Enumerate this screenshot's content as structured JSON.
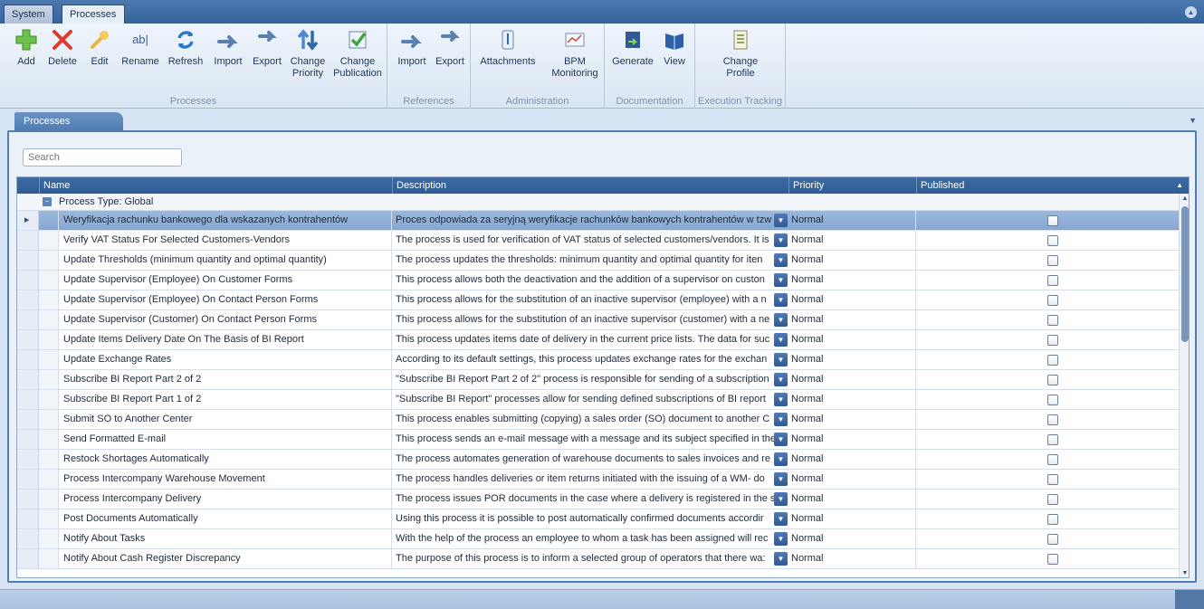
{
  "tabs": {
    "system": "System",
    "processes": "Processes"
  },
  "ribbon": {
    "groups": {
      "processes": "Processes",
      "references": "References",
      "administration": "Administration",
      "documentation": "Documentation",
      "execution_tracking": "Execution Tracking"
    },
    "buttons": {
      "add": "Add",
      "delete": "Delete",
      "edit": "Edit",
      "rename": "Rename",
      "refresh": "Refresh",
      "import": "Import",
      "export": "Export",
      "change_priority": "Change\nPriority",
      "change_publication": "Change\nPublication",
      "ref_import": "Import",
      "ref_export": "Export",
      "attachments": "Attachments",
      "bpm_monitoring": "BPM\nMonitoring",
      "generate": "Generate",
      "view": "View",
      "change_profile": "Change\nProfile"
    }
  },
  "doc_tab": "Processes",
  "search": {
    "placeholder": "Search"
  },
  "grid": {
    "columns": {
      "name": "Name",
      "description": "Description",
      "priority": "Priority",
      "published": "Published"
    },
    "group_label": "Process Type: Global",
    "rows": [
      {
        "name": "Weryfikacja rachunku bankowego dla wskazanych kontrahentów",
        "description": "Proces odpowiada za seryjną weryfikacje rachunków bankowych kontrahentów w tzw",
        "priority": "Normal",
        "published": false
      },
      {
        "name": "Verify VAT Status For Selected Customers-Vendors",
        "description": "The process is used for verification of VAT status of selected customers/vendors. It is",
        "priority": "Normal",
        "published": false
      },
      {
        "name": "Update Thresholds (minimum quantity and optimal quantity)",
        "description": "The process updates the thresholds: minimum quantity and optimal quantity for iten",
        "priority": "Normal",
        "published": false
      },
      {
        "name": "Update Supervisor (Employee) On Customer Forms",
        "description": "This process allows both the deactivation and the addition of a supervisor on custon",
        "priority": "Normal",
        "published": false
      },
      {
        "name": "Update Supervisor (Employee) On Contact Person Forms",
        "description": "This process allows for the substitution of an inactive supervisor (employee) with a n",
        "priority": "Normal",
        "published": false
      },
      {
        "name": "Update Supervisor (Customer) On Contact Person Forms",
        "description": "This process allows for the substitution of an inactive supervisor (customer) with a ne",
        "priority": "Normal",
        "published": false
      },
      {
        "name": "Update Items Delivery Date On The Basis of BI Report",
        "description": "This process updates items date of delivery in the current price lists. The data for suc",
        "priority": "Normal",
        "published": false
      },
      {
        "name": "Update Exchange Rates",
        "description": "According to its default settings, this process updates exchange rates for the exchan",
        "priority": "Normal",
        "published": false
      },
      {
        "name": "Subscribe BI Report Part 2 of 2",
        "description": "\"Subscribe BI Report Part 2 of 2\" process is responsible for sending of a subscription",
        "priority": "Normal",
        "published": false
      },
      {
        "name": "Subscribe BI Report Part 1 of 2",
        "description": "\"Subscribe BI Report\" processes allow for sending defined subscriptions of BI report",
        "priority": "Normal",
        "published": false
      },
      {
        "name": "Submit SO to Another Center",
        "description": "This process enables submitting (copying) a sales order (SO) document to another C",
        "priority": "Normal",
        "published": false
      },
      {
        "name": "Send Formatted E-mail",
        "description": "This process sends an e-mail message with a message and its subject specified in the",
        "priority": "Normal",
        "published": false
      },
      {
        "name": "Restock Shortages Automatically",
        "description": "The process automates generation of warehouse documents to sales invoices and re",
        "priority": "Normal",
        "published": false
      },
      {
        "name": "Process Intercompany Warehouse Movement",
        "description": "The process handles deliveries or item returns initiated with the issuing of a WM- do",
        "priority": "Normal",
        "published": false
      },
      {
        "name": "Process Intercompany Delivery",
        "description": "The process issues POR documents in the case where a delivery is registered in the s",
        "priority": "Normal",
        "published": false
      },
      {
        "name": "Post Documents Automatically",
        "description": "Using this process it is possible to post automatically confirmed documents accordir",
        "priority": "Normal",
        "published": false
      },
      {
        "name": "Notify About Tasks",
        "description": "With the help of the process an employee to whom a task has been assigned will rec",
        "priority": "Normal",
        "published": false
      },
      {
        "name": "Notify About Cash Register Discrepancy",
        "description": "The purpose of this process is to inform a selected group of operators that there wa:",
        "priority": "Normal",
        "published": false
      }
    ]
  }
}
